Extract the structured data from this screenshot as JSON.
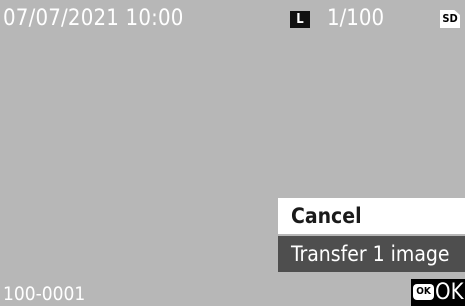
{
  "status_bar": {
    "datetime": "07/07/2021 10:00",
    "image_size_badge": "L",
    "shutter_speed": "1/100",
    "card_icon": "sd-card-icon",
    "card_label": "SD"
  },
  "menu": {
    "items": [
      {
        "label": "Cancel"
      },
      {
        "label": "Transfer 1 image"
      }
    ]
  },
  "footer": {
    "file_number": "100-0001",
    "ok_icon": "ok-button-icon",
    "ok_icon_label": "OK",
    "ok_label": "OK"
  },
  "colors": {
    "background": "#b7b7b7",
    "menu_selected_bg": "#ffffff",
    "menu_unselected_bg": "#4e4e4e"
  }
}
